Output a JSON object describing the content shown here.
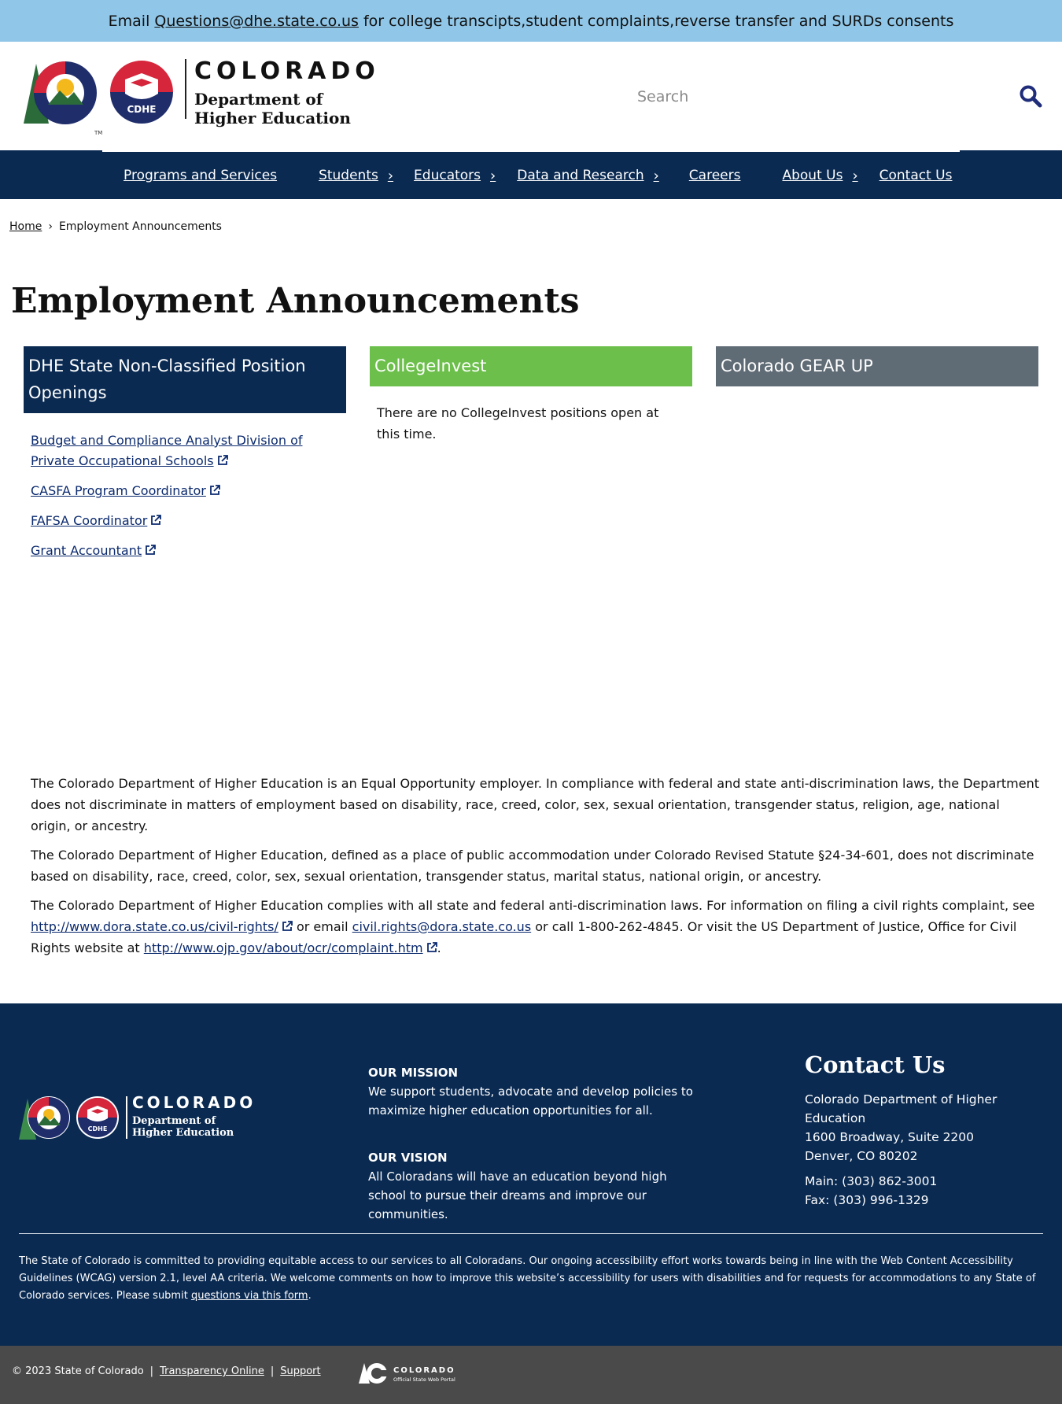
{
  "topbar": {
    "prefix": "Email",
    "email": "Questions@dhe.state.co.us",
    "suffix": "for college transcipts,student complaints,reverse transfer and SURDs consents"
  },
  "header": {
    "brand_word": "COLORADO",
    "dept_line1": "Department of",
    "dept_line2": "Higher Education",
    "badge": "CDHE",
    "tm": "TM",
    "search_placeholder": "Search"
  },
  "nav": {
    "items": [
      {
        "label": "Programs and Services",
        "has_submenu": false
      },
      {
        "label": "Students",
        "has_submenu": true
      },
      {
        "label": "Educators",
        "has_submenu": true
      },
      {
        "label": "Data and Research",
        "has_submenu": true
      },
      {
        "label": "Careers",
        "has_submenu": false
      },
      {
        "label": "About Us",
        "has_submenu": true
      },
      {
        "label": "Contact Us",
        "has_submenu": false
      }
    ]
  },
  "breadcrumb": {
    "home": "Home",
    "sep": "›",
    "current": "Employment Announcements"
  },
  "page_title": "Employment Announcements",
  "columns": {
    "dhe": {
      "title": "DHE State Non-Classified Position Openings",
      "jobs": [
        "Budget and Compliance Analyst Division of Private Occupational Schools",
        "CASFA Program Coordinator",
        "FAFSA Coordinator",
        "Grant Accountant"
      ]
    },
    "collegeinvest": {
      "title": "CollegeInvest",
      "text": "There are no CollegeInvest positions open at this time."
    },
    "gearup": {
      "title": "Colorado GEAR UP"
    }
  },
  "eeo": {
    "p1": "The Colorado Department of Higher Education is an Equal Opportunity employer.  In compliance with federal and state anti-discrimination laws, the Department does not discriminate in matters of employment based on disability, race, creed, color, sex, sexual orientation, transgender status, religion, age, national origin, or ancestry.",
    "p2": "The Colorado Department of Higher Education, defined as a place of public accommodation under Colorado Revised Statute §24-34-601, does not discriminate based on disability, race, creed, color, sex, sexual orientation, transgender status, marital status, national origin, or ancestry.",
    "p3_a": "The Colorado Department of Higher Education complies with all state and federal anti-discrimination laws. For information on filing  a civil rights complaint, see",
    "p3_link1": "http://www.dora.state.co.us/civil-rights/",
    "p3_b": "or email",
    "p3_link2": "civil.rights@dora.state.co.us",
    "p3_c": "or call 1-800-262-4845. Or visit the US Department of Justice, Office for Civil Rights website at",
    "p3_link3": "http://www.ojp.gov/about/ocr/complaint.htm",
    "p3_d": "."
  },
  "footer": {
    "mission_title": "OUR MISSION",
    "mission_text": "We support students, advocate and develop policies to maximize higher education opportunities for all.",
    "vision_title": "OUR VISION",
    "vision_text": "All Coloradans will have an education beyond high school to pursue their dreams and improve our communities.",
    "contact_title": "Contact Us",
    "org": "Colorado Department of Higher Education",
    "address1": "1600 Broadway, Suite 2200",
    "address2": "Denver, CO 80202",
    "main": "Main: (303) 862-3001",
    "fax": "Fax: (303) 996-1329",
    "accessibility": "The State of Colorado is committed to providing equitable access to our services to all Coloradans. Our ongoing accessibility effort works towards being in line with the Web Content Accessibility Guidelines (WCAG) version 2.1, level AA criteria. We welcome comments on how to improve this website’s accessibility for users with disabilities and for requests for accommodations to any State of Colorado services. Please submit",
    "accessibility_link": "questions via this form",
    "accessibility_end": "."
  },
  "bottom": {
    "copyright": "© 2023 State of Colorado",
    "sep": "|",
    "transparency": "Transparency Online",
    "support": "Support",
    "portal_word": "COLORADO",
    "portal_sub": "Official State Web Portal"
  },
  "colors": {
    "topbar": "#90c6e7",
    "navy": "#0a2a52",
    "green": "#6bbf4a",
    "slate": "#5f6b75",
    "red": "#d6263b",
    "gold": "#f3b81c",
    "pine": "#2b6b3a",
    "bottombar": "#4a4a4a"
  }
}
